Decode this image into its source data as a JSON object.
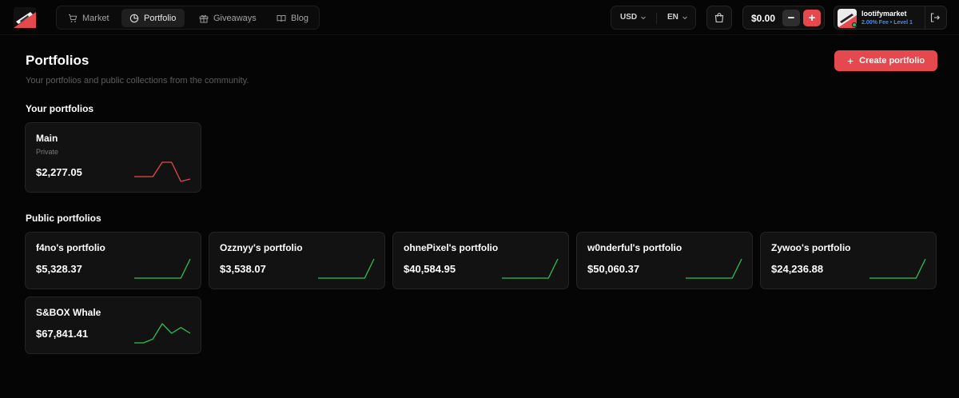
{
  "header": {
    "nav": [
      {
        "label": "Market",
        "icon": "cart-icon",
        "active": false
      },
      {
        "label": "Portfolio",
        "icon": "pie-chart-icon",
        "active": true
      },
      {
        "label": "Giveaways",
        "icon": "gift-icon",
        "active": false
      },
      {
        "label": "Blog",
        "icon": "book-icon",
        "active": false
      }
    ],
    "currency": "USD",
    "language": "EN",
    "balance": "$0.00",
    "user": {
      "name": "lootifymarket",
      "fee_level": "2.00% Fee • Level 1",
      "online": true
    }
  },
  "page": {
    "title": "Portfolios",
    "subtitle": "Your portfolios and public collections from the community.",
    "create_button": "Create portfolio",
    "your_section": "Your portfolios",
    "public_section": "Public portfolios"
  },
  "colors": {
    "accent": "#e5484d",
    "sparkline_down": "#e5484d",
    "sparkline_up": "#2fbf55",
    "user_sub": "#4a8cf0"
  },
  "your_portfolios": [
    {
      "name": "Main",
      "privacy": "Private",
      "value": "$2,277.05",
      "trend": [
        10,
        10,
        10,
        16,
        16,
        8,
        9
      ],
      "direction": "down"
    }
  ],
  "public_portfolios": [
    {
      "name": "f4no's portfolio",
      "value": "$5,328.37",
      "trend": [
        0,
        0,
        0,
        0,
        0,
        0,
        10
      ],
      "direction": "up"
    },
    {
      "name": "Ozznyy's portfolio",
      "value": "$3,538.07",
      "trend": [
        0,
        0,
        0,
        0,
        0,
        0,
        10
      ],
      "direction": "up"
    },
    {
      "name": "ohnePixel's portfolio",
      "value": "$40,584.95",
      "trend": [
        0,
        0,
        0,
        0,
        0,
        0,
        10
      ],
      "direction": "up"
    },
    {
      "name": "w0nderful's portfolio",
      "value": "$50,060.37",
      "trend": [
        0,
        0,
        0,
        0,
        0,
        0,
        10
      ],
      "direction": "up"
    },
    {
      "name": "Zywoo's portfolio",
      "value": "$24,236.88",
      "trend": [
        0,
        0,
        0,
        0,
        0,
        0,
        10
      ],
      "direction": "up"
    },
    {
      "name": "S&BOX Whale",
      "value": "$67,841.41",
      "trend": [
        0,
        0,
        2,
        10,
        5,
        8,
        5
      ],
      "direction": "up"
    }
  ]
}
